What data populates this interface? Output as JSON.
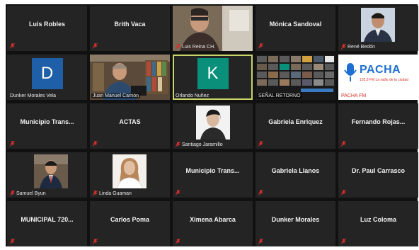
{
  "colors": {
    "tile_bg": "#242424",
    "muted_mic": "#d9302c",
    "active_border": "#c9d56a",
    "avatar_blue": "#1f5fa8",
    "avatar_teal": "#0a8f7a",
    "pacha_blue": "#1e6fd1",
    "pacha_red": "#d6322c"
  },
  "tiles": [
    {
      "name": "Luis Robles",
      "muted": true
    },
    {
      "name": "Brith Vaca",
      "muted": true
    },
    {
      "name": "Luis Reina CH.",
      "muted": true,
      "video": true
    },
    {
      "name": "Mónica Sandoval",
      "muted": true
    },
    {
      "name": "René Bedón",
      "muted": true,
      "video": true
    },
    {
      "name": "Dunker Morales Vela",
      "avatar_letter": "D",
      "muted": false
    },
    {
      "name": "Juan Manuel Carrión",
      "muted": false,
      "video": true
    },
    {
      "name": "Orlando Nuñez",
      "avatar_letter": "K",
      "muted": false,
      "active": true
    },
    {
      "name": "SEÑAL RETORNO",
      "muted": false,
      "video": true
    },
    {
      "name": "PACHA FM",
      "muted": false,
      "logo_text": "PACHA",
      "logo_sub": "102.9 FM  La radio de la ciudad"
    },
    {
      "name": "Municipio  Trans...",
      "muted": true
    },
    {
      "name": "ACTAS",
      "muted": true
    },
    {
      "name": "Santiago Jaramillo",
      "muted": true,
      "video": true
    },
    {
      "name": "Gabriela Enriquez",
      "muted": true
    },
    {
      "name": "Fernando  Rojas...",
      "muted": true
    },
    {
      "name": "Samuel Byun",
      "muted": true,
      "video": true
    },
    {
      "name": "Linda Guaman",
      "muted": true,
      "video": true
    },
    {
      "name": "Municipio  Trans...",
      "muted": true
    },
    {
      "name": "Gabriela Llanos",
      "muted": true
    },
    {
      "name": "Dr. Paul Carrasco",
      "muted": true
    },
    {
      "name": "MUNICIPAL  720...",
      "muted": true
    },
    {
      "name": "Carlos Poma",
      "muted": true
    },
    {
      "name": "Ximena Abarca",
      "muted": true
    },
    {
      "name": "Dunker Morales",
      "muted": true
    },
    {
      "name": "Luz Coloma",
      "muted": true
    }
  ]
}
